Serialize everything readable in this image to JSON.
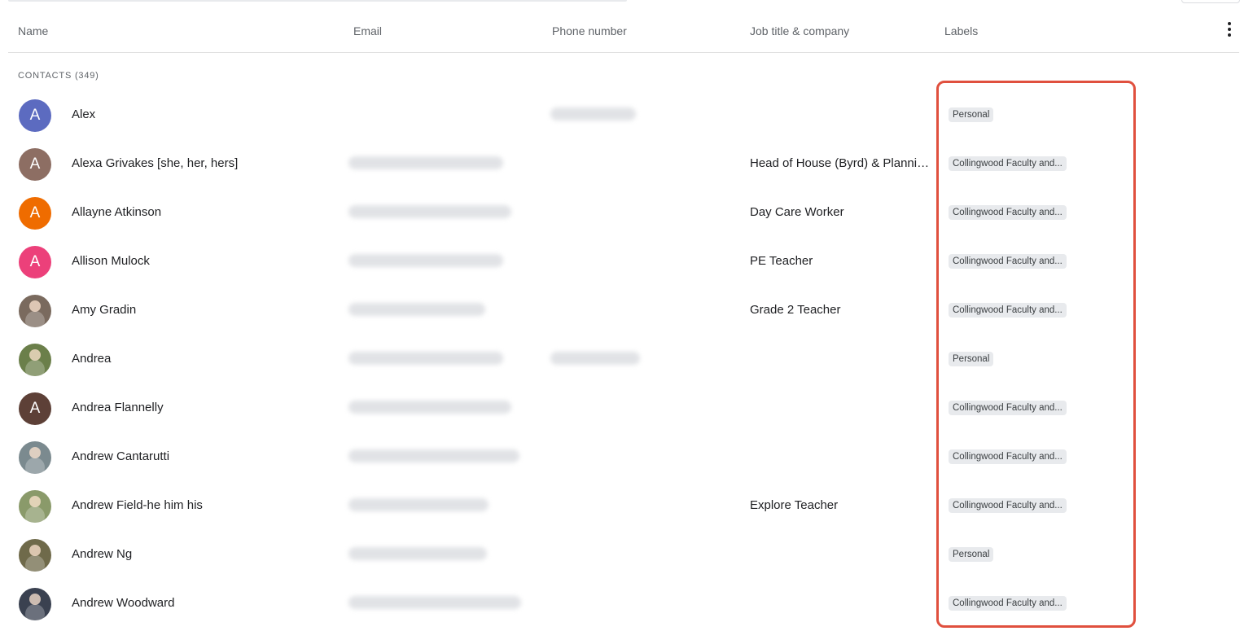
{
  "columns": {
    "name": "Name",
    "email": "Email",
    "phone": "Phone number",
    "job": "Job title & company",
    "labels": "Labels"
  },
  "section_title": "CONTACTS (349)",
  "icons": {
    "more": "more-vert-icon"
  },
  "colors": {
    "highlight": "#e0503e",
    "chip_bg": "#e8eaed"
  },
  "contacts": [
    {
      "initial": "A",
      "name": "Alex",
      "job": "",
      "label": "Personal",
      "avatar_color": "#5c6bc0"
    },
    {
      "initial": "A",
      "name": "Alexa Grivakes [she, her, hers]",
      "job": "Head of House (Byrd) & Planning and Programming",
      "label": "Collingwood Faculty and...",
      "avatar_color": "#8d6e63"
    },
    {
      "initial": "A",
      "name": "Allayne Atkinson",
      "job": "Day Care Worker",
      "label": "Collingwood Faculty and...",
      "avatar_color": "#ef6c00"
    },
    {
      "initial": "A",
      "name": "Allison Mulock",
      "job": "PE Teacher",
      "label": "Collingwood Faculty and...",
      "avatar_color": "#ec407a"
    },
    {
      "initial": "",
      "name": "Amy Gradin",
      "job": "Grade 2 Teacher",
      "label": "Collingwood Faculty and...",
      "avatar_color": "#7a6a5e"
    },
    {
      "initial": "",
      "name": "Andrea",
      "job": "",
      "label": "Personal",
      "avatar_color": "#6b7f4a"
    },
    {
      "initial": "A",
      "name": "Andrea Flannelly",
      "job": "",
      "label": "Collingwood Faculty and...",
      "avatar_color": "#5d4037"
    },
    {
      "initial": "",
      "name": "Andrew Cantarutti",
      "job": "",
      "label": "Collingwood Faculty and...",
      "avatar_color": "#7b8a8f"
    },
    {
      "initial": "",
      "name": "Andrew Field-he him his",
      "job": "Explore Teacher",
      "label": "Collingwood Faculty and...",
      "avatar_color": "#8a9a6a"
    },
    {
      "initial": "",
      "name": "Andrew Ng",
      "job": "",
      "label": "Personal",
      "avatar_color": "#6f6a4a"
    },
    {
      "initial": "",
      "name": "Andrew Woodward",
      "job": "",
      "label": "Collingwood Faculty and...",
      "avatar_color": "#3a4150"
    }
  ]
}
